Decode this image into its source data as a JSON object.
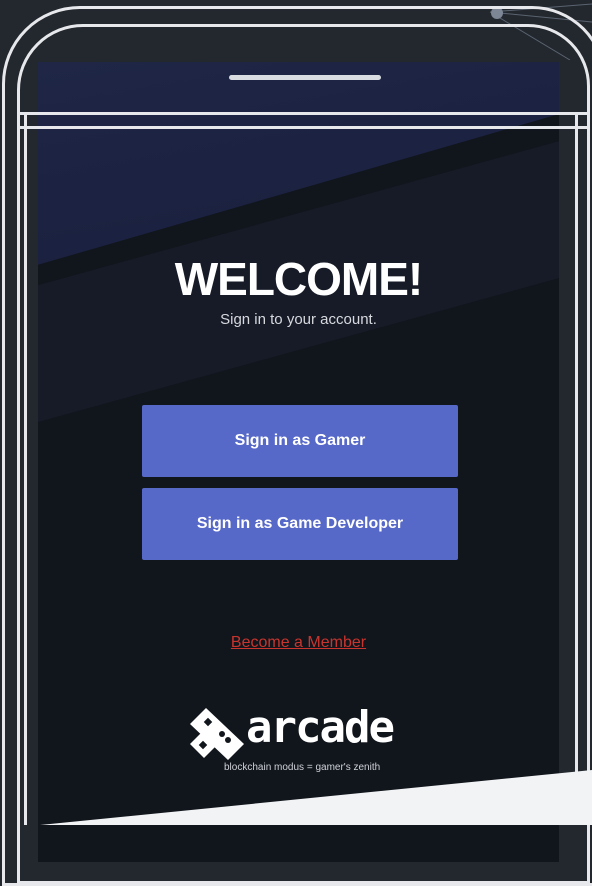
{
  "screen": {
    "title": "WELCOME!",
    "subtitle": "Sign in to your account."
  },
  "actions": {
    "gamer_label": "Sign in as Gamer",
    "developer_label": "Sign in as Game Developer",
    "member_link": "Become a Member"
  },
  "brand": {
    "name": "arcade",
    "tagline": "blockchain modus = gamer's zenith",
    "icon": "game-controller-logo"
  },
  "colors": {
    "background": "#23282e",
    "screen": "#11151c",
    "button": "#5668c8",
    "link": "#c8352e",
    "frame": "#e6e8ec"
  }
}
